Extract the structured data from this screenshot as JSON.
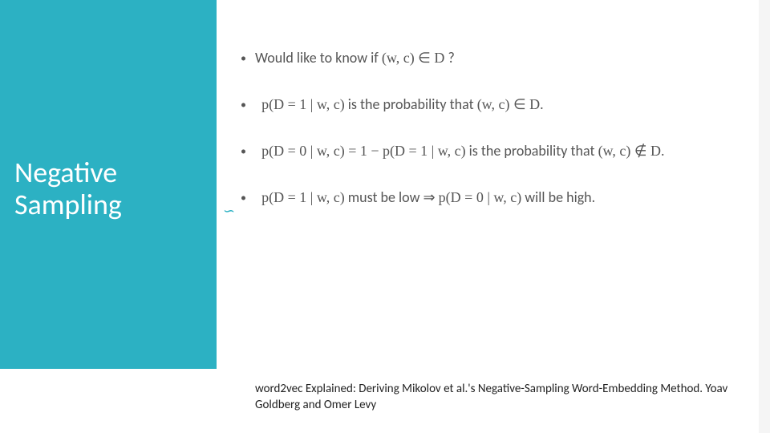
{
  "title": "Negative Sampling",
  "bullets": [
    {
      "pre": "Would like to know if ",
      "math": "(w, c) ∈ D",
      "post": " ?"
    },
    {
      "math1": "p(D = 1 | w, c)",
      "mid": " is the probability that ",
      "math2": "(w, c) ∈ D."
    },
    {
      "math1": "p(D = 0 | w, c) = 1 − p(D = 1 | w, c)",
      "mid": " is the probability that ",
      "math2": "(w, c) ∉ D."
    },
    {
      "math1": "p(D = 1 | w, c)",
      "mid": " must be low ⇒ ",
      "math2": "p(D = 0 | w, c)",
      "post": " will be high."
    }
  ],
  "flourish": "∽",
  "citation": "word2vec Explained: Deriving Mikolov et al.'s Negative-Sampling Word-Embedding Method. Yoav Goldberg and Omer Levy"
}
